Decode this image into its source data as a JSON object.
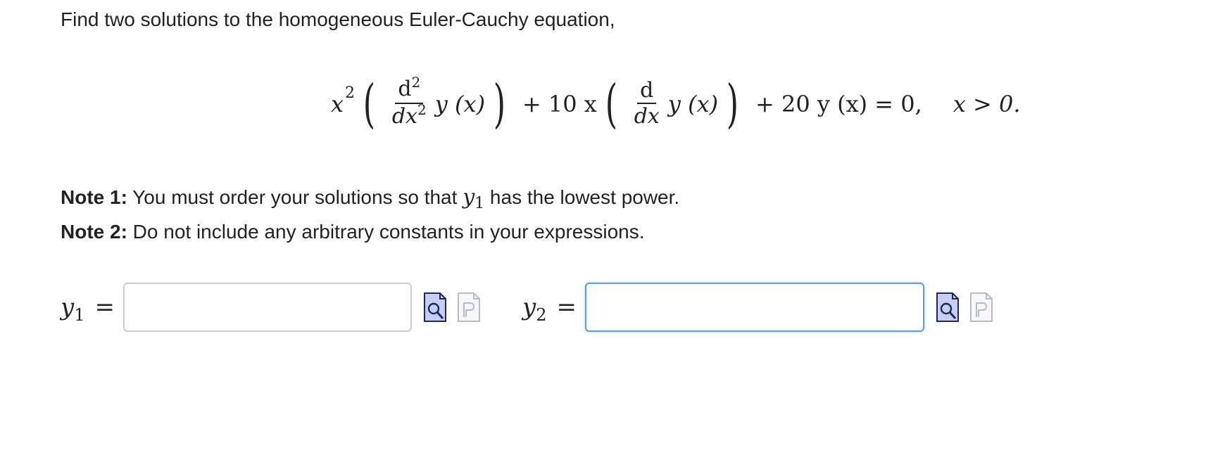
{
  "question": {
    "prompt": "Find two solutions to the homogeneous Euler-Cauchy equation,"
  },
  "equation": {
    "x": "x",
    "exp2": "2",
    "d": "d",
    "dx": "dx",
    "yx": "y (x)",
    "plus10x": "+ 10 x",
    "plus20": "+ 20 y (x) = 0,",
    "condition": "x > 0."
  },
  "notes": {
    "note1_label": "Note 1:",
    "note1_before": " You must order your solutions so that ",
    "note1_var": "y",
    "note1_sub": "1",
    "note1_after": " has the lowest power.",
    "note2_label": "Note 2:",
    "note2_text": " Do not include any arbitrary constants in your expressions."
  },
  "answers": [
    {
      "var": "y",
      "sub": "1",
      "eq": "=",
      "value": "",
      "preview_icon": "preview-icon",
      "paste_icon": "paste-icon"
    },
    {
      "var": "y",
      "sub": "2",
      "eq": "=",
      "value": "",
      "preview_icon": "preview-icon",
      "paste_icon": "paste-icon"
    }
  ],
  "colors": {
    "text": "#222222",
    "input_border": "#cccccc",
    "input_focus_border": "#5b9ee8",
    "preview_icon_fill": "#c8cdf2",
    "preview_icon_stroke": "#1c2a5a",
    "paste_icon_stroke": "#b9bcc4"
  }
}
